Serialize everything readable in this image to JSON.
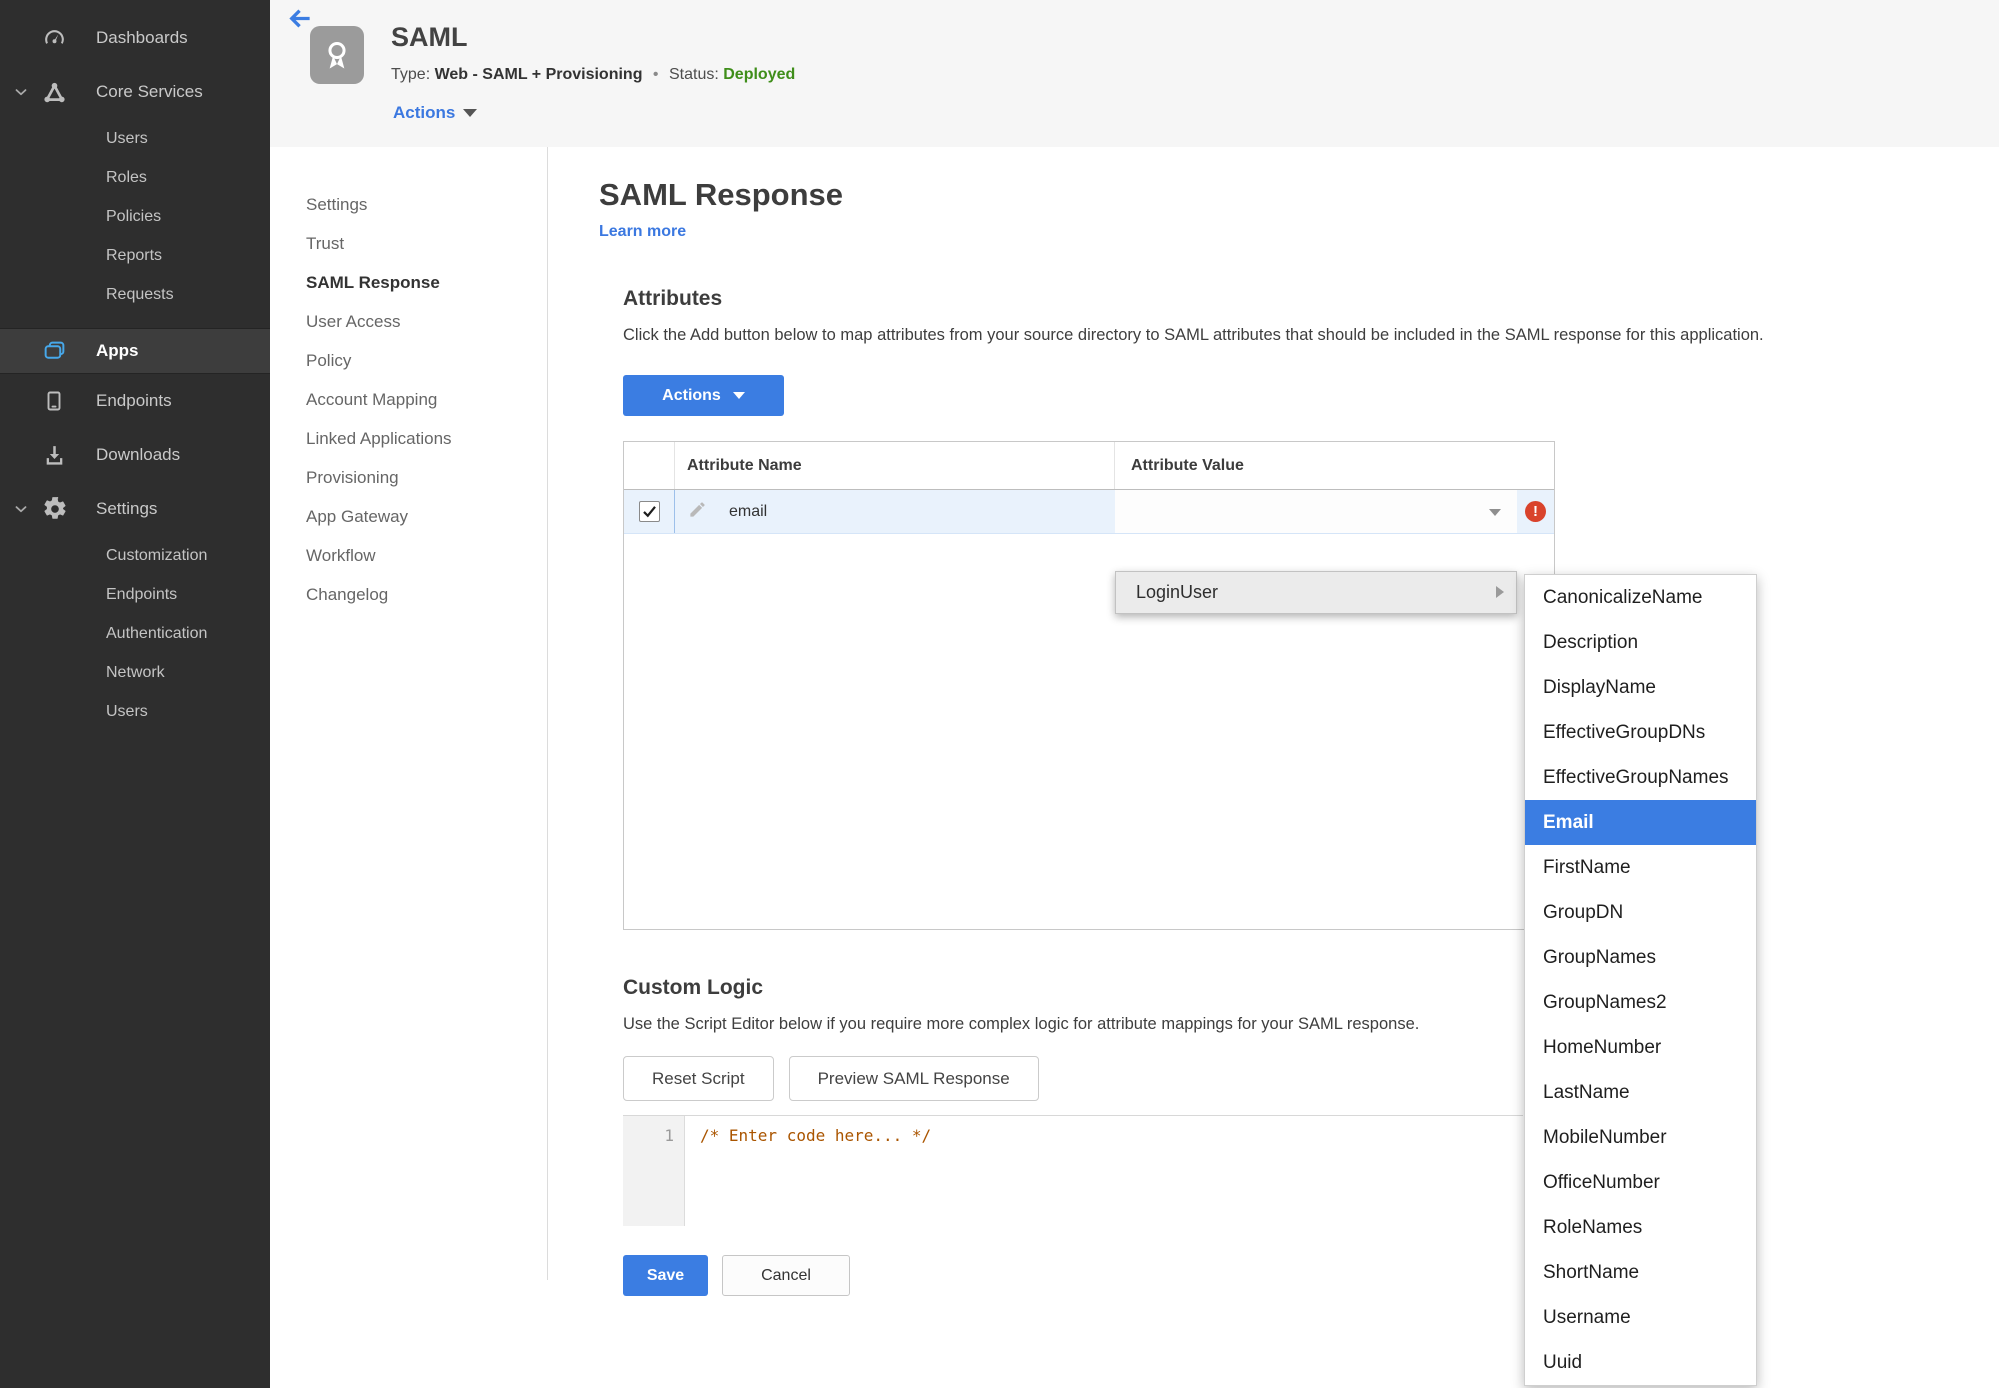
{
  "sidebar": {
    "items": [
      "Dashboards",
      "Core Services",
      "Users",
      "Roles",
      "Policies",
      "Reports",
      "Requests",
      "Apps",
      "Endpoints",
      "Downloads",
      "Settings",
      "Customization",
      "Endpoints",
      "Authentication",
      "Network",
      "Users"
    ],
    "active_item": "Apps"
  },
  "header": {
    "title": "SAML",
    "type_label": "Type:",
    "type_value": "Web - SAML + Provisioning",
    "dot": "•",
    "status_label": "Status:",
    "status_value": "Deployed",
    "actions_label": "Actions"
  },
  "subnav": {
    "items": [
      "Settings",
      "Trust",
      "SAML Response",
      "User Access",
      "Policy",
      "Account Mapping",
      "Linked Applications",
      "Provisioning",
      "App Gateway",
      "Workflow",
      "Changelog"
    ],
    "active_item": "SAML Response"
  },
  "main": {
    "page_title": "SAML Response",
    "learn_more": "Learn more",
    "attributes": {
      "heading": "Attributes",
      "description": "Click the Add button below to map attributes from your source directory to SAML attributes that should be included in the SAML response for this application.",
      "actions_button": "Actions",
      "table": {
        "columns": [
          "Attribute Name",
          "Attribute Value"
        ],
        "rows": [
          {
            "name": "email",
            "value": "",
            "checked": true,
            "error": true
          }
        ]
      }
    },
    "custom_logic": {
      "heading": "Custom Logic",
      "description": "Use the Script Editor below if you require more complex logic for attribute mappings for your SAML response.",
      "reset_button": "Reset Script",
      "preview_button": "Preview SAML Response",
      "editor": {
        "line_number": "1",
        "code": "/* Enter code here... */"
      }
    },
    "save_button": "Save",
    "cancel_button": "Cancel"
  },
  "context_menu": {
    "label": "LoginUser"
  },
  "submenu": {
    "items": [
      "CanonicalizeName",
      "Description",
      "DisplayName",
      "EffectiveGroupDNs",
      "EffectiveGroupNames",
      "Email",
      "FirstName",
      "GroupDN",
      "GroupNames",
      "GroupNames2",
      "HomeNumber",
      "LastName",
      "MobileNumber",
      "OfficeNumber",
      "RoleNames",
      "ShortName",
      "Username",
      "Uuid"
    ],
    "selected_item": "Email"
  },
  "icons": {
    "exclamation": "!"
  },
  "colors": {
    "accent_blue": "#3b7de2",
    "status_green": "#3f8e1a",
    "error_red": "#d9432c",
    "sidebar_bg": "#2e2e2e",
    "row_highlight": "#e9f2fc"
  }
}
